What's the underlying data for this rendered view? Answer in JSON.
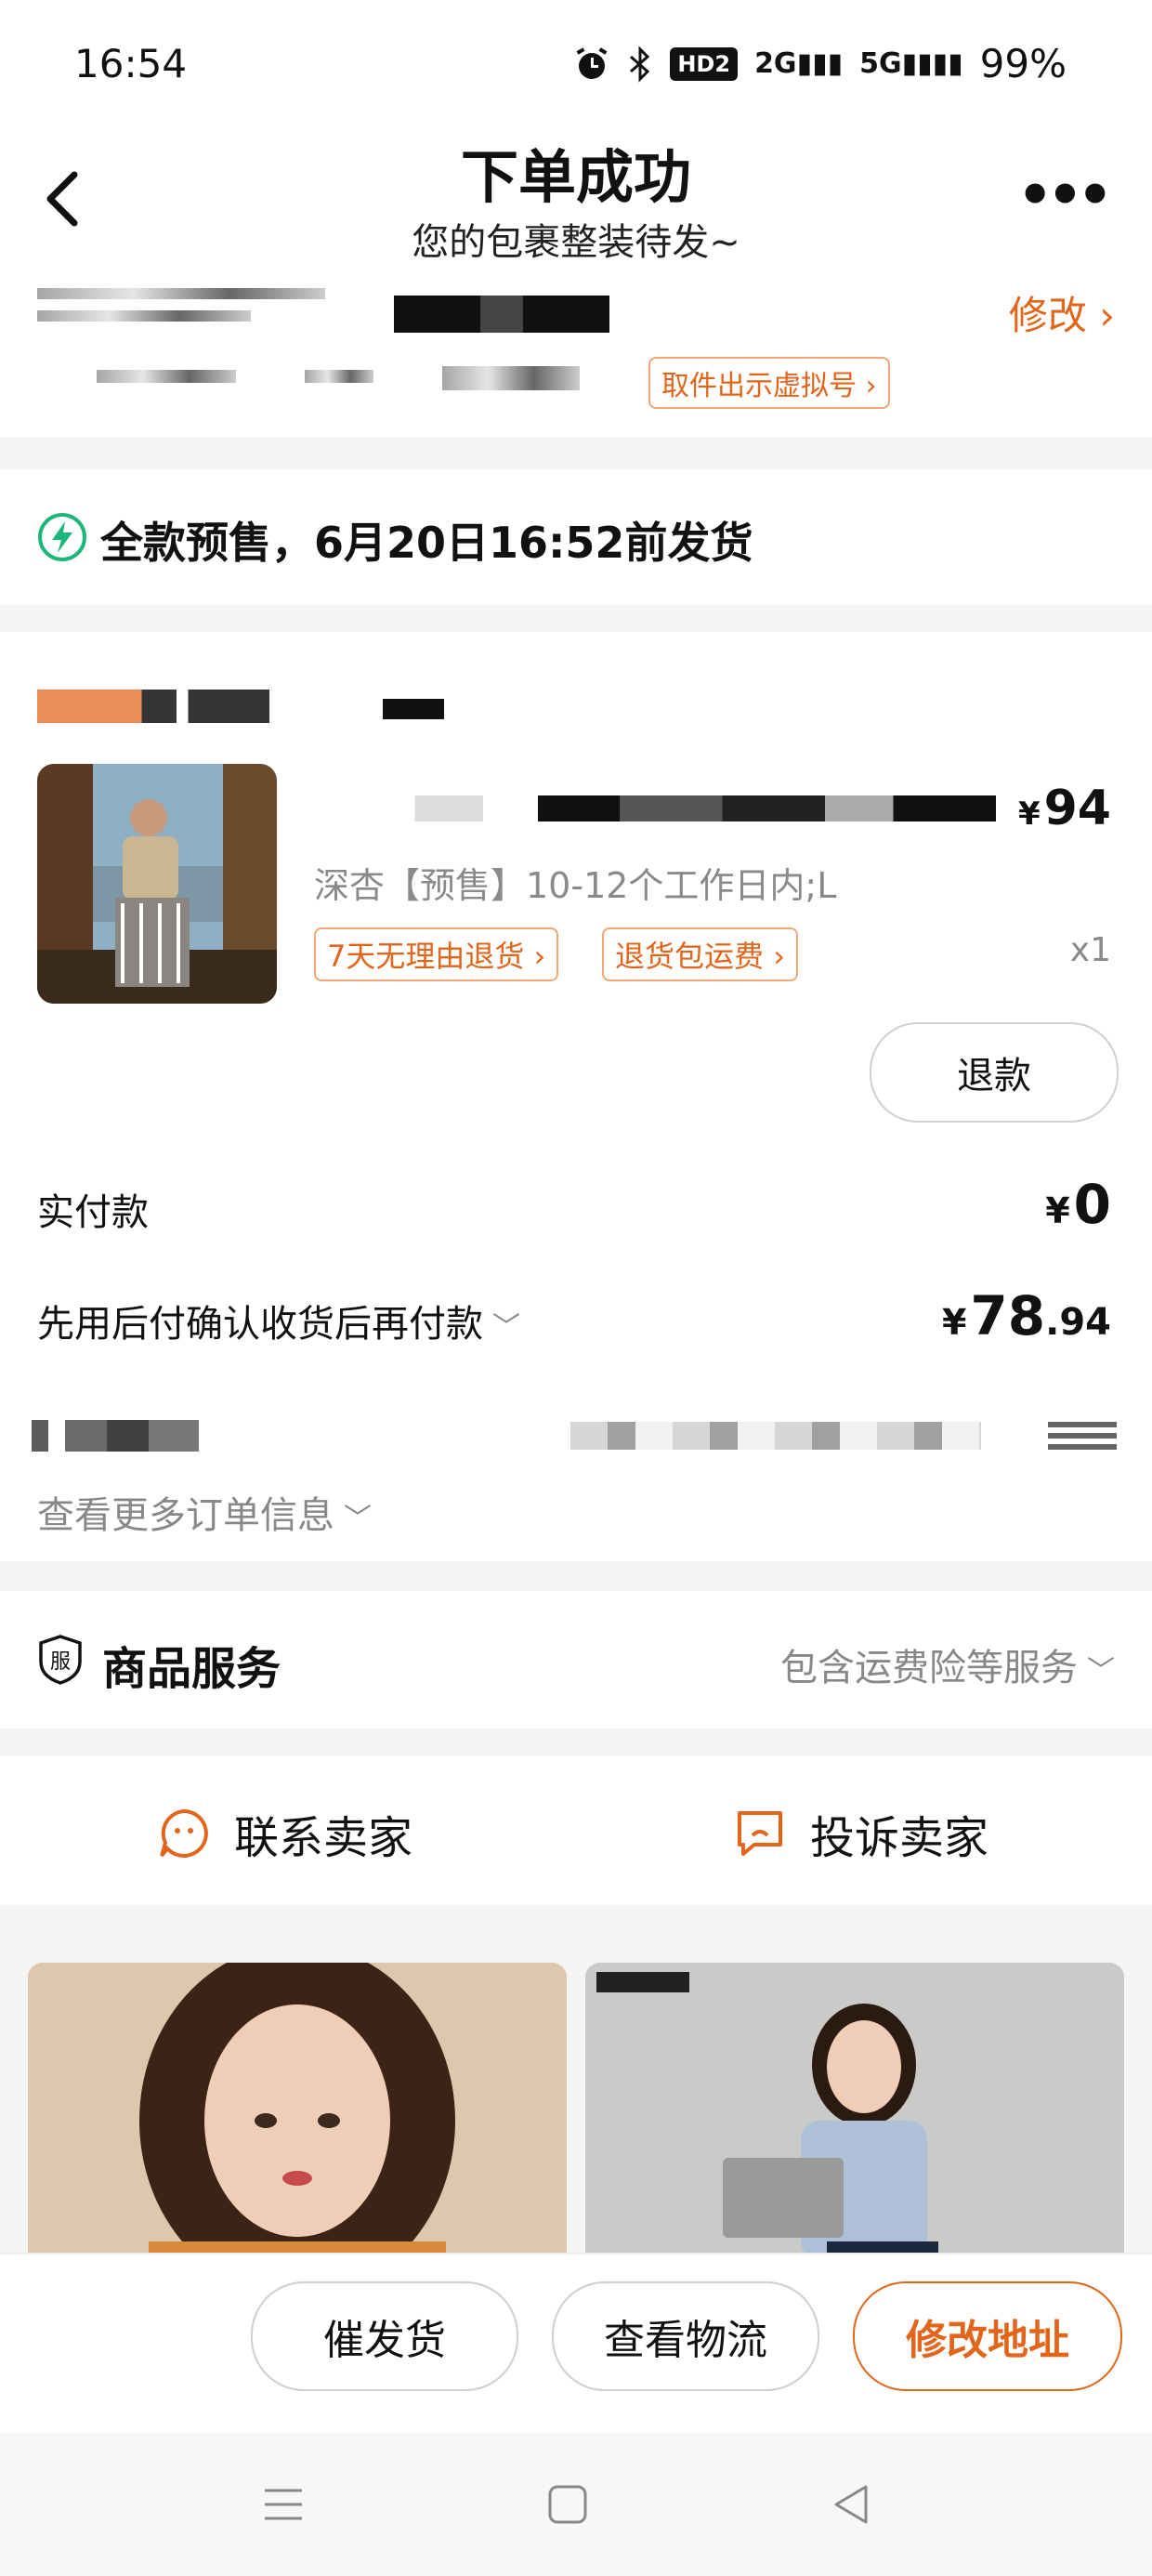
{
  "status_bar": {
    "time": "16:54",
    "icons": [
      "alarm-icon",
      "bluetooth-icon",
      "hd-icon",
      "signal-2g-icon",
      "signal-5g-icon"
    ],
    "hd_label": "HD2",
    "sig1_label": "2G",
    "sig2_label": "5G",
    "battery": "99%"
  },
  "header": {
    "title": "下单成功",
    "subtitle": "您的包裹整装待发~",
    "modify_label": "修改",
    "pickup_label": "取件出示虚拟号"
  },
  "presale": {
    "text": "全款预售，6月20日16:52前发货",
    "icon": "bolt-icon"
  },
  "order": {
    "price_currency": "¥",
    "price": "94",
    "variant": "深杏【预售】10-12个工作日内;L",
    "tags": [
      "7天无理由退货",
      "退货包运费"
    ],
    "quantity": "x1",
    "refund_label": "退款",
    "paid_label": "实付款",
    "paid_currency": "¥",
    "paid_value": "0",
    "later_label": "先用后付确认收货后再付款",
    "later_currency": "¥",
    "later_int": "78",
    "later_dec": ".94",
    "more_info_label": "查看更多订单信息"
  },
  "service": {
    "title": "商品服务",
    "icon_char": "服",
    "description": "包含运费险等服务"
  },
  "contact": {
    "seller_label": "联系卖家",
    "complain_label": "投诉卖家"
  },
  "actions": {
    "urge_label": "催发货",
    "logistics_label": "查看物流",
    "address_label": "修改地址"
  },
  "colors": {
    "accent": "#e2651c",
    "presale_green": "#1bb77a",
    "background": "#f5f5f5"
  }
}
